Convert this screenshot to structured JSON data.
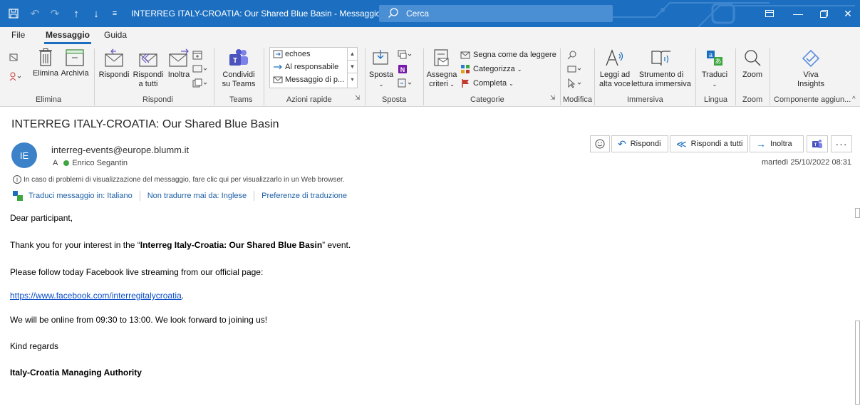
{
  "window": {
    "title": "INTERREG ITALY-CROATIA: Our Shared Blue Basin  -  Messaggio (HTML)",
    "search_label": "Cerca"
  },
  "menu": {
    "tabs": [
      "File",
      "Messaggio",
      "Guida"
    ],
    "active_tab": "Messaggio"
  },
  "ribbon": {
    "elimina": {
      "delete_label": "Elimina",
      "archive_label": "Archivia",
      "group_label": "Elimina"
    },
    "rispondi": {
      "reply_label": "Rispondi",
      "reply_all_label": "Rispondi a tutti",
      "reply_all_line1": "Rispondi",
      "reply_all_line2": "a tutti",
      "forward_label": "Inoltra",
      "group_label": "Rispondi"
    },
    "teams": {
      "share_line1": "Condividi",
      "share_line2": "su Teams",
      "group_label": "Teams"
    },
    "quick_steps": {
      "items": [
        "echoes",
        "Al responsabile",
        "Messaggio di p..."
      ],
      "group_label": "Azioni rapide"
    },
    "sposta": {
      "move_label": "Sposta",
      "group_label": "Sposta"
    },
    "categorie": {
      "assign_line1": "Assegna",
      "assign_line2": "criteri",
      "mark_read": "Segna come da leggere",
      "categorize": "Categorizza",
      "complete": "Completa",
      "group_label": "Categorie"
    },
    "modifica": {
      "group_label": "Modifica"
    },
    "immersiva": {
      "read_aloud_line1": "Leggi ad",
      "read_aloud_line2": "alta voce",
      "reader_line1": "Strumento di",
      "reader_line2": "lettura immersiva",
      "group_label": "Immersiva"
    },
    "lingua": {
      "translate_label": "Traduci",
      "group_label": "Lingua"
    },
    "zoom": {
      "zoom_label": "Zoom",
      "group_label": "Zoom"
    },
    "addins": {
      "viva_line1": "Viva",
      "viva_line2": "Insights",
      "group_label": "Componente aggiun..."
    }
  },
  "message": {
    "subject": "INTERREG ITALY-CROATIA: Our Shared Blue Basin",
    "avatar_initials": "IE",
    "sender": "interreg-events@europe.blumm.it",
    "to_prefix": "A",
    "recipient": "Enrico Segantin",
    "info_notice": "In caso di problemi di visualizzazione del messaggio, fare clic qui per visualizzarlo in un Web browser.",
    "translate": {
      "translate_to": "Traduci messaggio in: Italiano",
      "never_translate": "Non tradurre mai da: Inglese",
      "preferences": "Preferenze di traduzione"
    },
    "actions": {
      "reply": "Rispondi",
      "reply_all": "Rispondi a tutti",
      "forward": "Inoltra"
    },
    "date": "martedì 25/10/2022 08:31"
  },
  "body": {
    "greeting": "Dear participant,",
    "thanks_prefix": "Thank you for your interest in the “",
    "thanks_event": "Interreg Italy-Croatia: Our Shared Blue Basin",
    "thanks_suffix": "” event.",
    "follow": "Please follow today Facebook live streaming from our official page:",
    "link": "https://www.facebook.com/interregitalycroatia",
    "link_suffix": ".",
    "online": "We will be online from 09:30 to 13:00. We look forward to joining us!",
    "regards": "Kind regards",
    "signature": "Italy-Croatia Managing Authority"
  },
  "colors": {
    "titlebar": "#1c6fc0",
    "accent": "#1c6fc0",
    "link": "#0b4dc9",
    "status_green": "#3ea63e"
  }
}
